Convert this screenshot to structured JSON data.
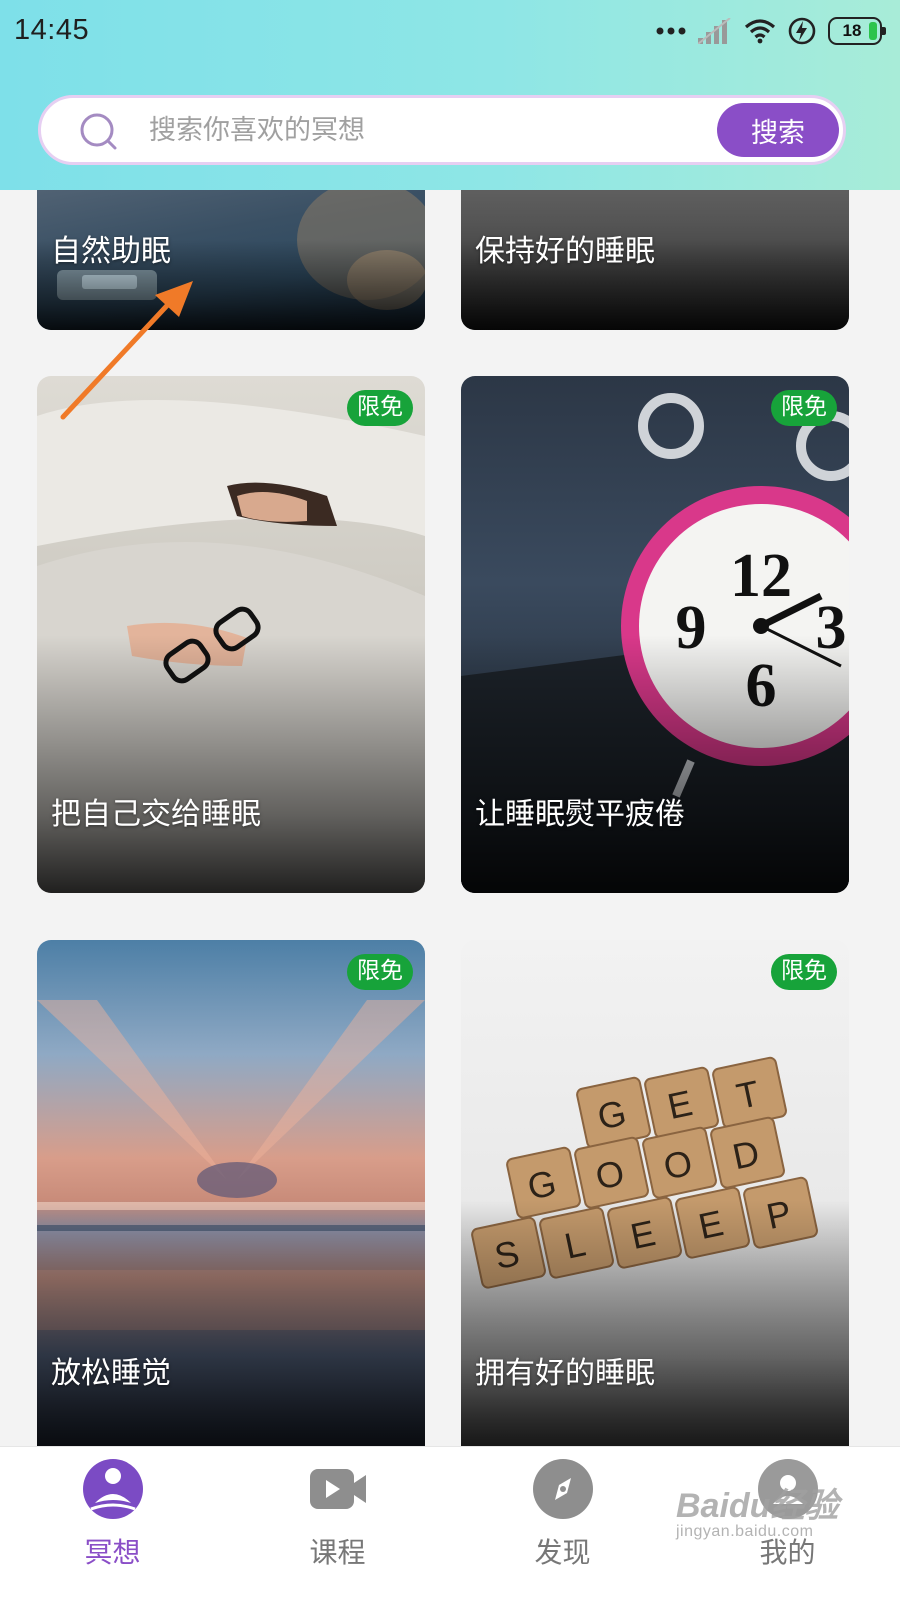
{
  "status_bar": {
    "time": "14:45",
    "battery": "18"
  },
  "search": {
    "placeholder": "搜索你喜欢的冥想",
    "button_label": "搜索"
  },
  "cards": [
    {
      "title": "自然助眠",
      "badge": ""
    },
    {
      "title": "保持好的睡眠",
      "badge": ""
    },
    {
      "title": "把自己交给睡眠",
      "badge": "限免"
    },
    {
      "title": "让睡眠熨平疲倦",
      "badge": "限免"
    },
    {
      "title": "放松睡觉",
      "badge": "限免"
    },
    {
      "title": "拥有好的睡眠",
      "badge": "限免"
    }
  ],
  "scrabble_tiles": [
    "G",
    "E",
    "T",
    "G",
    "O",
    "O",
    "D",
    "S",
    "L",
    "E",
    "E",
    "P"
  ],
  "clock_numerals": [
    "12",
    "9",
    "3",
    "6"
  ],
  "tabs": [
    {
      "label": "冥想",
      "icon": "meditation-icon",
      "active": true
    },
    {
      "label": "课程",
      "icon": "video-icon",
      "active": false
    },
    {
      "label": "发现",
      "icon": "compass-icon",
      "active": false
    },
    {
      "label": "我的",
      "icon": "profile-icon",
      "active": false
    }
  ],
  "watermark": {
    "main": "Baidu经验",
    "sub": "jingyan.baidu.com"
  },
  "colors": {
    "accent": "#8a4ec7",
    "badge": "#17a33a",
    "header_gradient_start": "#7ee0e9",
    "annotation_arrow": "#f07a28"
  }
}
